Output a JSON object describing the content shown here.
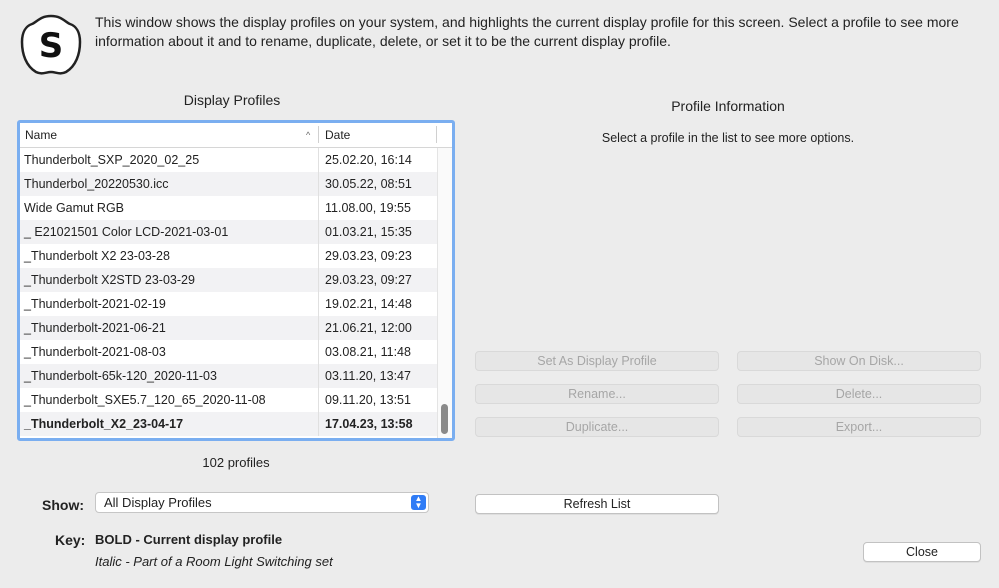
{
  "intro_text": "This window shows the display profiles on your system, and highlights the current display profile for this screen. Select a profile to see more information about it and to rename, duplicate, delete, or set it to be the current display profile.",
  "logo_icon": "s-logo-icon",
  "profiles_title": "Display Profiles",
  "columns": {
    "name": "Name",
    "date": "Date"
  },
  "sort_indicator": "^",
  "rows": [
    {
      "name": "Thunderbolt_SXP_2020_02_25",
      "date": "25.02.20, 16:14"
    },
    {
      "name": "Thunderbol_20220530.icc",
      "date": "30.05.22, 08:51"
    },
    {
      "name": "Wide Gamut RGB",
      "date": "11.08.00, 19:55"
    },
    {
      "name": "_ E21021501 Color LCD-2021-03-01",
      "date": "01.03.21, 15:35"
    },
    {
      "name": "_Thunderbolt X2 23-03-28",
      "date": "29.03.23, 09:23"
    },
    {
      "name": "_Thunderbolt X2STD 23-03-29",
      "date": "29.03.23, 09:27"
    },
    {
      "name": "_Thunderbolt-2021-02-19",
      "date": "19.02.21, 14:48"
    },
    {
      "name": "_Thunderbolt-2021-06-21",
      "date": "21.06.21, 12:00"
    },
    {
      "name": "_Thunderbolt-2021-08-03",
      "date": "03.08.21, 11:48"
    },
    {
      "name": "_Thunderbolt-65k-120_2020-11-03",
      "date": "03.11.20, 13:47"
    },
    {
      "name": "_Thunderbolt_SXE5.7_120_65_2020-11-08",
      "date": "09.11.20, 13:51"
    },
    {
      "name": "_Thunderbolt_X2_23-04-17",
      "date": "17.04.23, 13:58"
    }
  ],
  "profile_count": "102 profiles",
  "show_label": "Show:",
  "show_value": "All Display Profiles",
  "key_label": "Key:",
  "key_bold": "BOLD - Current display profile",
  "key_italic": "Italic - Part of a Room Light Switching set",
  "info_title": "Profile Information",
  "info_subtitle": "Select a profile in the list to see more options.",
  "buttons": {
    "set_display": "Set As Display Profile",
    "show_disk": "Show On Disk...",
    "rename": "Rename...",
    "delete": "Delete...",
    "duplicate": "Duplicate...",
    "export": "Export...",
    "refresh": "Refresh List",
    "close": "Close"
  },
  "colors": {
    "selection_border": "#7aaef0",
    "accent": "#2f7cf6"
  }
}
